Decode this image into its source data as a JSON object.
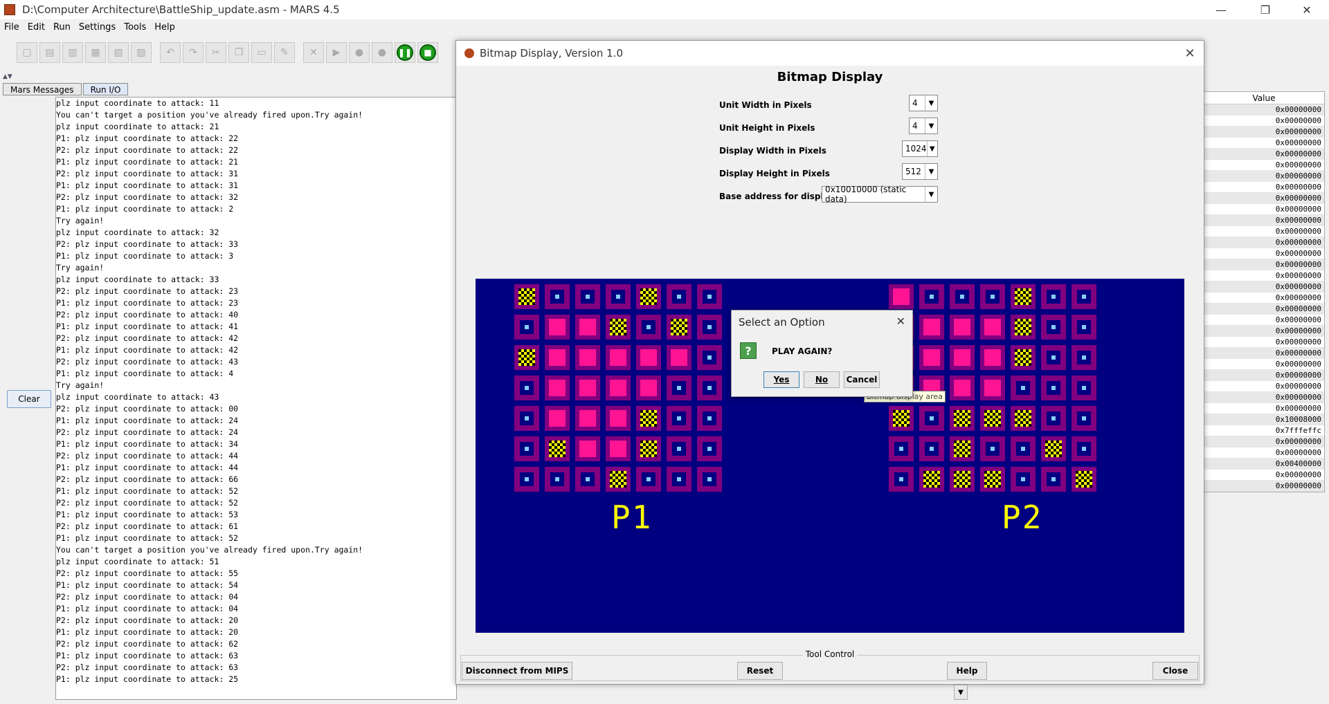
{
  "window": {
    "title": "D:\\Computer Architecture\\BattleShip_update.asm  - MARS 4.5",
    "minimize": "—",
    "maximize": "❐",
    "close": "✕"
  },
  "menu": {
    "file": "File",
    "edit": "Edit",
    "run": "Run",
    "settings": "Settings",
    "tools": "Tools",
    "help": "Help"
  },
  "tabs": {
    "messages": "Mars Messages",
    "run_io": "Run I/O"
  },
  "clear_label": "Clear",
  "console_lines": [
    "plz input coordinate to attack: 11",
    "You can't target a position you've already fired upon.Try again!",
    "plz input coordinate to attack: 21",
    "P1: plz input coordinate to attack: 22",
    "P2: plz input coordinate to attack: 22",
    "P1: plz input coordinate to attack: 21",
    "P2: plz input coordinate to attack: 31",
    "P1: plz input coordinate to attack: 31",
    "P2: plz input coordinate to attack: 32",
    "P1: plz input coordinate to attack: 2",
    "Try again!",
    "plz input coordinate to attack: 32",
    "P2: plz input coordinate to attack: 33",
    "P1: plz input coordinate to attack: 3",
    "Try again!",
    "plz input coordinate to attack: 33",
    "P2: plz input coordinate to attack: 23",
    "P1: plz input coordinate to attack: 23",
    "P2: plz input coordinate to attack: 40",
    "P1: plz input coordinate to attack: 41",
    "P2: plz input coordinate to attack: 42",
    "P1: plz input coordinate to attack: 42",
    "P2: plz input coordinate to attack: 43",
    "P1: plz input coordinate to attack: 4",
    "Try again!",
    "plz input coordinate to attack: 43",
    "P2: plz input coordinate to attack: 00",
    "P1: plz input coordinate to attack: 24",
    "P2: plz input coordinate to attack: 24",
    "P1: plz input coordinate to attack: 34",
    "P2: plz input coordinate to attack: 44",
    "P1: plz input coordinate to attack: 44",
    "P2: plz input coordinate to attack: 66",
    "P1: plz input coordinate to attack: 52",
    "P2: plz input coordinate to attack: 52",
    "P1: plz input coordinate to attack: 53",
    "P2: plz input coordinate to attack: 61",
    "P1: plz input coordinate to attack: 52",
    "You can't target a position you've already fired upon.Try again!",
    "plz input coordinate to attack: 51",
    "P2: plz input coordinate to attack: 55",
    "P1: plz input coordinate to attack: 54",
    "P2: plz input coordinate to attack: 04",
    "P1: plz input coordinate to attack: 04",
    "P2: plz input coordinate to attack: 20",
    "P1: plz input coordinate to attack: 20",
    "P2: plz input coordinate to attack: 62",
    "P1: plz input coordinate to attack: 63",
    "P2: plz input coordinate to attack: 63",
    "P1: plz input coordinate to attack: 25"
  ],
  "registers": {
    "header": "Value",
    "values": [
      "0x00000000",
      "0x00000000",
      "0x00000000",
      "0x00000000",
      "0x00000000",
      "0x00000000",
      "0x00000000",
      "0x00000000",
      "0x00000000",
      "0x00000000",
      "0x00000000",
      "0x00000000",
      "0x00000000",
      "0x00000000",
      "0x00000000",
      "0x00000000",
      "0x00000000",
      "0x00000000",
      "0x00000000",
      "0x00000000",
      "0x00000000",
      "0x00000000",
      "0x00000000",
      "0x00000000",
      "0x00000000",
      "0x00000000",
      "0x00000000",
      "0x00000000",
      "0x10008000",
      "0x7fffeffc",
      "0x00000000",
      "0x00000000",
      "0x00400000",
      "0x00000000",
      "0x00000000"
    ]
  },
  "bitmap": {
    "window_title": "Bitmap Display, Version 1.0",
    "heading": "Bitmap Display",
    "unit_width_label": "Unit Width in Pixels",
    "unit_width_value": "4",
    "unit_height_label": "Unit Height in Pixels",
    "unit_height_value": "4",
    "display_width_label": "Display Width in Pixels",
    "display_width_value": "1024",
    "display_height_label": "Display Height in Pixels",
    "display_height_value": "512",
    "base_address_label": "Base address for display",
    "base_address_value": "0x10010000 (static data)",
    "tool_control_label": "Tool Control",
    "disconnect_label": "Disconnect from MIPS",
    "reset_label": "Reset",
    "help_label": "Help",
    "close_label": "Close",
    "tooltip": "Bitmap display area"
  },
  "game": {
    "p1_label": "P1",
    "p2_label": "P2",
    "colors": {
      "background": "#000080",
      "frame": "#800080",
      "hit": "#ff1493",
      "ship_marker": "#ffff00",
      "empty_inner": "#000080",
      "dot": "#87cefa"
    },
    "p1_grid": [
      [
        "X",
        "E",
        "E",
        "E",
        "X",
        "E",
        "E"
      ],
      [
        "E",
        "H",
        "H",
        "X",
        "E",
        "X",
        "E"
      ],
      [
        "X",
        "H",
        "H",
        "H",
        "H",
        "H",
        "E"
      ],
      [
        "E",
        "H",
        "H",
        "H",
        "H",
        "E",
        "E"
      ],
      [
        "E",
        "H",
        "H",
        "H",
        "X",
        "E",
        "E"
      ],
      [
        "E",
        "X",
        "H",
        "H",
        "X",
        "E",
        "E"
      ],
      [
        "E",
        "E",
        "E",
        "X",
        "E",
        "E",
        "E"
      ]
    ],
    "p2_grid": [
      [
        "H",
        "E",
        "E",
        "E",
        "X",
        "E",
        "E"
      ],
      [
        "E",
        "H",
        "H",
        "H",
        "X",
        "E",
        "E"
      ],
      [
        "H",
        "H",
        "H",
        "H",
        "X",
        "E",
        "E"
      ],
      [
        "E",
        "H",
        "H",
        "H",
        "E",
        "E",
        "E"
      ],
      [
        "X",
        "E",
        "X",
        "X",
        "X",
        "E",
        "E"
      ],
      [
        "E",
        "E",
        "X",
        "E",
        "E",
        "X",
        "E"
      ],
      [
        "E",
        "X",
        "X",
        "X",
        "E",
        "E",
        "X"
      ]
    ]
  },
  "dialog": {
    "title": "Select an Option",
    "close": "✕",
    "icon": "?",
    "message": "PLAY AGAIN?",
    "yes": "Yes",
    "no": "No",
    "cancel": "Cancel"
  }
}
